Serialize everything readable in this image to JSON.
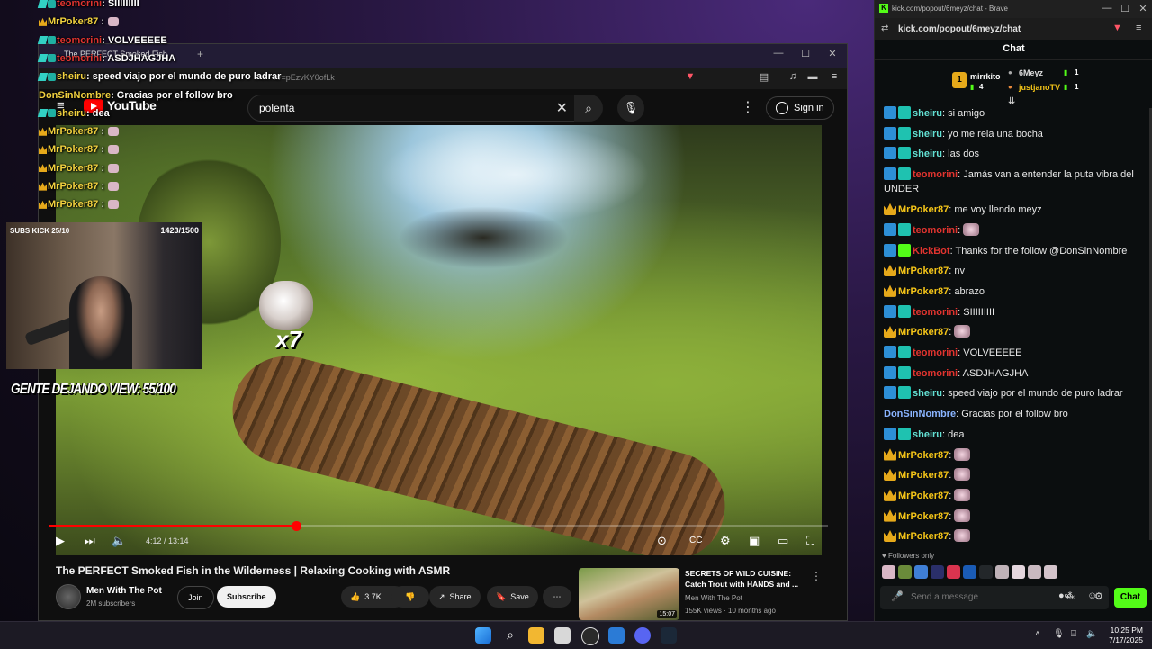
{
  "overlay_chat": [
    {
      "badge": "teal",
      "user": "teomorini",
      "color": "red",
      "text": ": SIIIIIIIII",
      "emote": false
    },
    {
      "badge": "crown",
      "user": "MrPoker87",
      "color": "yel",
      "text": " :",
      "emote": true
    },
    {
      "badge": "teal",
      "user": "teomorini",
      "color": "red",
      "text": ": VOLVEEEEE",
      "emote": false
    },
    {
      "badge": "teal",
      "user": "teomorini",
      "color": "red",
      "text": ": ASDJHAGJHA",
      "emote": false
    },
    {
      "badge": "teal",
      "user": "sheiru",
      "color": "yel",
      "text": ": speed viajo por el mundo de puro ladrar",
      "emote": false
    },
    {
      "badge": "none",
      "user": "DonSinNombre",
      "color": "yel",
      "text": ": Gracias por el follow bro",
      "emote": false
    },
    {
      "badge": "teal",
      "user": "sheiru",
      "color": "yel",
      "text": ": dea",
      "emote": false
    },
    {
      "badge": "crown",
      "user": "MrPoker87",
      "color": "yel",
      "text": " :",
      "emote": true
    },
    {
      "badge": "crown",
      "user": "MrPoker87",
      "color": "yel",
      "text": " :",
      "emote": true
    },
    {
      "badge": "crown",
      "user": "MrPoker87",
      "color": "yel",
      "text": " :",
      "emote": true
    },
    {
      "badge": "crown",
      "user": "MrPoker87",
      "color": "yel",
      "text": " :",
      "emote": true
    },
    {
      "badge": "crown",
      "user": "MrPoker87",
      "color": "yel",
      "text": " :",
      "emote": true
    }
  ],
  "stream_overlay": {
    "subs_label": "SUBS KICK 25/10",
    "counter": "1423/1500",
    "gente_text": "GENTE DEJANDO VIEW: 55/100",
    "multiplier": "x7"
  },
  "yt_browser": {
    "tab_title": "The PERFECT Smoked Fish",
    "url": "?v=pEzvKY0ofLk",
    "logo_text": "YouTube",
    "search_value": "polenta",
    "search_placeholder": "Search",
    "signin_label": "Sign in"
  },
  "player": {
    "timecode": "4:12 / 13:14",
    "progress_fraction": 0.317
  },
  "video_info": {
    "title": "The PERFECT Smoked Fish in the Wilderness | Relaxing Cooking with ASMR",
    "channel": "Men With The Pot",
    "subscribers": "2M subscribers",
    "join_label": "Join",
    "subscribe_label": "Subscribe",
    "likes": "3.7K",
    "share_label": "Share",
    "save_label": "Save"
  },
  "recommendation": {
    "title": "SECRETS OF WILD CUISINE: Catch Trout with HANDS and ...",
    "channel": "Men With The Pot",
    "meta": "155K views · 10 months ago",
    "duration": "15:07"
  },
  "kick": {
    "window_title": "kick.com/popout/6meyz/chat - Brave",
    "url": "kick.com/popout/6meyz/chat",
    "header": "Chat",
    "leaderboard": {
      "top": {
        "rank": "1",
        "name": "mirrkito",
        "value": "4"
      },
      "second": {
        "name": "6Meyz",
        "value": "1"
      },
      "third": {
        "name": "justjanoTV",
        "value": "1"
      }
    },
    "messages": [
      {
        "badges": [
          "vip",
          "sub"
        ],
        "user": "sheiru",
        "color": "teal",
        "text": "si amigo",
        "emote": false
      },
      {
        "badges": [
          "vip",
          "sub"
        ],
        "user": "sheiru",
        "color": "teal",
        "text": "yo me reia una bocha",
        "emote": false
      },
      {
        "badges": [
          "vip",
          "sub"
        ],
        "user": "sheiru",
        "color": "teal",
        "text": "las dos",
        "emote": false
      },
      {
        "badges": [
          "vip",
          "sub"
        ],
        "user": "teomorini",
        "color": "red",
        "text": "Jamás van a entender la puta vibra del UNDER",
        "emote": false,
        "wrap": true
      },
      {
        "badges": [
          "crown"
        ],
        "user": "MrPoker87",
        "color": "yel",
        "text": "me voy llendo meyz",
        "emote": false
      },
      {
        "badges": [
          "vip",
          "sub"
        ],
        "user": "teomorini",
        "color": "red",
        "text": "",
        "emote": true
      },
      {
        "badges": [
          "vip",
          "bot"
        ],
        "user": "KickBot",
        "color": "red",
        "text": "Thanks for the follow @DonSinNombre",
        "emote": false
      },
      {
        "badges": [
          "crown"
        ],
        "user": "MrPoker87",
        "color": "yel",
        "text": "nv",
        "emote": false
      },
      {
        "badges": [
          "crown"
        ],
        "user": "MrPoker87",
        "color": "yel",
        "text": "abrazo",
        "emote": false
      },
      {
        "badges": [
          "vip",
          "sub"
        ],
        "user": "teomorini",
        "color": "red",
        "text": "SIIIIIIIII",
        "emote": false
      },
      {
        "badges": [
          "crown"
        ],
        "user": "MrPoker87",
        "color": "yel",
        "text": "",
        "emote": true
      },
      {
        "badges": [
          "vip",
          "sub"
        ],
        "user": "teomorini",
        "color": "red",
        "text": "VOLVEEEEE",
        "emote": false
      },
      {
        "badges": [
          "vip",
          "sub"
        ],
        "user": "teomorini",
        "color": "red",
        "text": "ASDJHAGJHA",
        "emote": false
      },
      {
        "badges": [
          "vip",
          "sub"
        ],
        "user": "sheiru",
        "color": "teal",
        "text": "speed viajo por el mundo de puro ladrar",
        "emote": false
      },
      {
        "badges": [],
        "user": "DonSinNombre",
        "color": "blue",
        "text": "Gracias por el follow bro",
        "emote": false
      },
      {
        "badges": [
          "vip",
          "sub"
        ],
        "user": "sheiru",
        "color": "teal",
        "text": "dea",
        "emote": false
      },
      {
        "badges": [
          "crown"
        ],
        "user": "MrPoker87",
        "color": "yel",
        "text": "",
        "emote": true
      },
      {
        "badges": [
          "crown"
        ],
        "user": "MrPoker87",
        "color": "yel",
        "text": "",
        "emote": true
      },
      {
        "badges": [
          "crown"
        ],
        "user": "MrPoker87",
        "color": "yel",
        "text": "",
        "emote": true
      },
      {
        "badges": [
          "crown"
        ],
        "user": "MrPoker87",
        "color": "yel",
        "text": "",
        "emote": true
      },
      {
        "badges": [
          "crown"
        ],
        "user": "MrPoker87",
        "color": "yel",
        "text": "",
        "emote": true
      }
    ],
    "followers_only": "Followers only",
    "input_placeholder": "Send a message",
    "chat_button": "Chat"
  },
  "taskbar": {
    "time": "10:25 PM",
    "date": "7/17/2025"
  },
  "colors": {
    "kick_green": "#53fc18",
    "yt_red": "#ff0000",
    "name_red": "#e2342f",
    "name_yellow": "#f5c518",
    "name_teal": "#63e0d3"
  }
}
